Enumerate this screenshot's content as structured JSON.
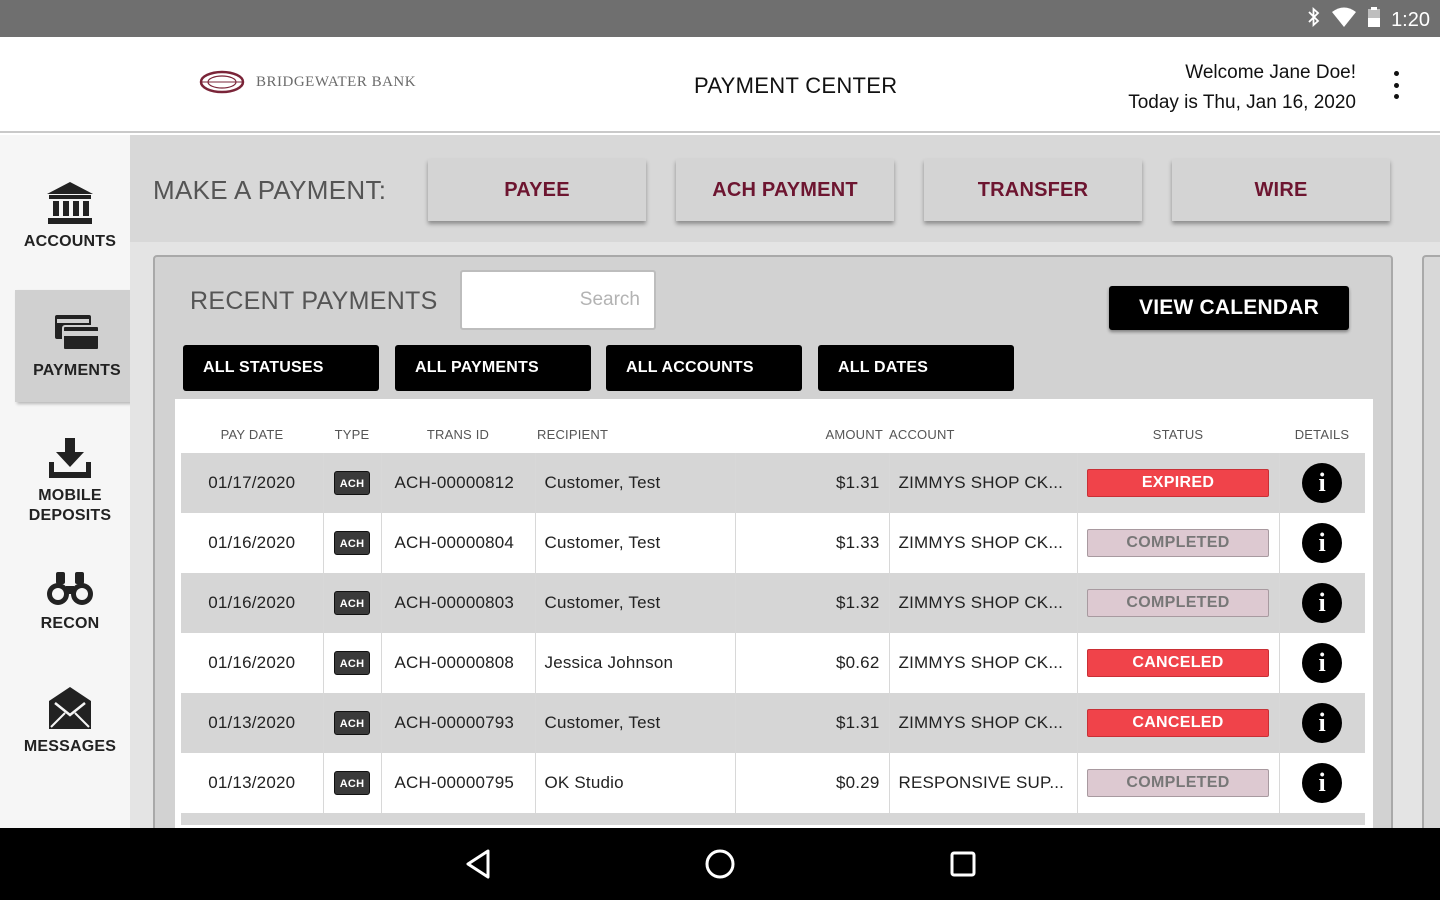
{
  "status_bar": {
    "time": "1:20",
    "icons": [
      "bluetooth-icon",
      "wifi-icon",
      "battery-icon"
    ]
  },
  "header": {
    "logo_text": "BRIDGEWATER BANK",
    "title": "PAYMENT CENTER",
    "welcome": "Welcome Jane Doe!",
    "date_line": "Today is Thu, Jan 16, 2020",
    "menu_icon": "more-vert-icon"
  },
  "sidebar": {
    "items": [
      {
        "label": "ACCOUNTS",
        "icon": "bank-icon",
        "active": false
      },
      {
        "label": "PAYMENTS",
        "icon": "card-icon",
        "active": true
      },
      {
        "label": "MOBILE\nDEPOSITS",
        "label_line1": "MOBILE",
        "label_line2": "DEPOSITS",
        "icon": "download-tray-icon",
        "active": false
      },
      {
        "label": "RECON",
        "icon": "binoculars-icon",
        "active": false
      },
      {
        "label": "MESSAGES",
        "icon": "envelope-icon",
        "active": false
      }
    ]
  },
  "make_payment": {
    "label": "MAKE A PAYMENT:",
    "buttons": [
      "PAYEE",
      "ACH PAYMENT",
      "TRANSFER",
      "WIRE"
    ]
  },
  "recent_payments": {
    "title": "RECENT PAYMENTS",
    "search_placeholder": "Search",
    "view_calendar": "VIEW CALENDAR",
    "filters": [
      "ALL STATUSES",
      "ALL PAYMENTS",
      "ALL ACCOUNTS",
      "ALL DATES"
    ],
    "columns": [
      "PAY DATE",
      "TYPE",
      "TRANS ID",
      "RECIPIENT",
      "AMOUNT",
      "ACCOUNT",
      "STATUS",
      "DETAILS"
    ],
    "rows": [
      {
        "pay_date": "01/17/2020",
        "type": "ACH",
        "trans_id": "ACH-00000812",
        "recipient": "Customer, Test",
        "amount": "$1.31",
        "account": "ZIMMYS SHOP CK...",
        "status": "EXPIRED"
      },
      {
        "pay_date": "01/16/2020",
        "type": "ACH",
        "trans_id": "ACH-00000804",
        "recipient": "Customer, Test",
        "amount": "$1.33",
        "account": "ZIMMYS SHOP CK...",
        "status": "COMPLETED"
      },
      {
        "pay_date": "01/16/2020",
        "type": "ACH",
        "trans_id": "ACH-00000803",
        "recipient": "Customer, Test",
        "amount": "$1.32",
        "account": "ZIMMYS SHOP CK...",
        "status": "COMPLETED"
      },
      {
        "pay_date": "01/16/2020",
        "type": "ACH",
        "trans_id": "ACH-00000808",
        "recipient": "Jessica Johnson",
        "amount": "$0.62",
        "account": "ZIMMYS SHOP CK...",
        "status": "CANCELED"
      },
      {
        "pay_date": "01/13/2020",
        "type": "ACH",
        "trans_id": "ACH-00000793",
        "recipient": "Customer, Test",
        "amount": "$1.31",
        "account": "ZIMMYS SHOP CK...",
        "status": "CANCELED"
      },
      {
        "pay_date": "01/13/2020",
        "type": "ACH",
        "trans_id": "ACH-00000795",
        "recipient": "OK Studio",
        "amount": "$0.29",
        "account": "RESPONSIVE SUP...",
        "status": "COMPLETED"
      }
    ],
    "details_icon": "info-icon"
  },
  "colors": {
    "brand": "#6d1530",
    "status_red": "#f0434a",
    "status_completed": "#ddc9d1"
  },
  "system_nav": [
    "back-icon",
    "home-icon",
    "recents-icon"
  ]
}
